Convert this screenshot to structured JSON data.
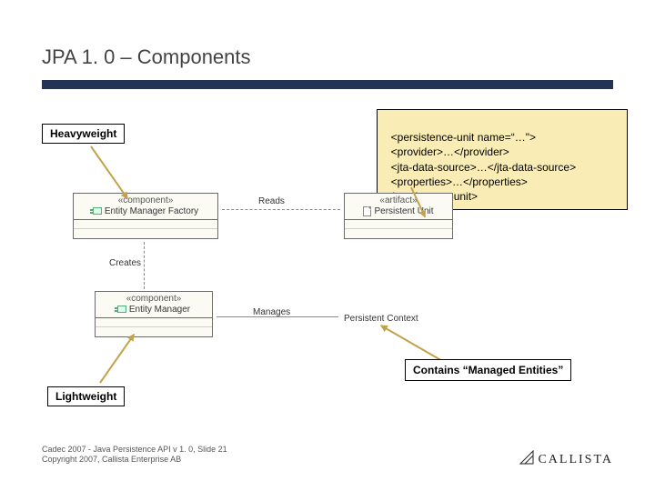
{
  "title": "JPA 1. 0 – Components",
  "callouts": {
    "heavyweight": "Heavyweight",
    "lightweight": "Lightweight",
    "managed": "Contains “Managed Entities”"
  },
  "xml_lines": [
    "<persistence-unit name=“…\">",
    "  <provider>…</provider>",
    "  <jta-data-source>…</jta-data-source>",
    "  <properties>…</properties>",
    "</persistence-unit>"
  ],
  "uml": {
    "factory": {
      "stereo": "«component»",
      "name": "Entity Manager Factory"
    },
    "manager": {
      "stereo": "«component»",
      "name": "Entity Manager"
    },
    "unit": {
      "stereo": "«artifact»",
      "name": "Persistent Unit"
    },
    "context": {
      "name": "Persistent Context"
    },
    "rel": {
      "reads": "Reads",
      "creates": "Creates",
      "manages": "Manages"
    }
  },
  "footer": {
    "line1": "Cadec 2007 - Java Persistence API v 1. 0, Slide 21",
    "line2": "Copyright 2007, Callista Enterprise AB"
  },
  "logo": "CALLISTA"
}
